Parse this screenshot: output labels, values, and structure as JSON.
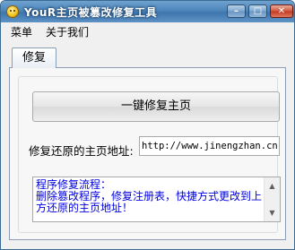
{
  "window": {
    "title": "YouR主页被篡改修复工具",
    "controls": {
      "minimize": "–",
      "maximize": "□",
      "close": "✕"
    }
  },
  "menu": [
    "菜单",
    "关于我们"
  ],
  "tabs": [
    {
      "label": "修复"
    }
  ],
  "main": {
    "repair_button": "一键修复主页",
    "url_label": "修复还原的主页地址:",
    "url_value": "http://www.jinengzhan.cn",
    "notes_text": "程序修复流程：\n删除篡改程序，修复注册表，快捷方式更改到上方还原的主页地址！"
  },
  "colors": {
    "title_bar": "#4d86bb",
    "notes_text": "#0000e0",
    "window_bg": "#f0f0f0"
  }
}
